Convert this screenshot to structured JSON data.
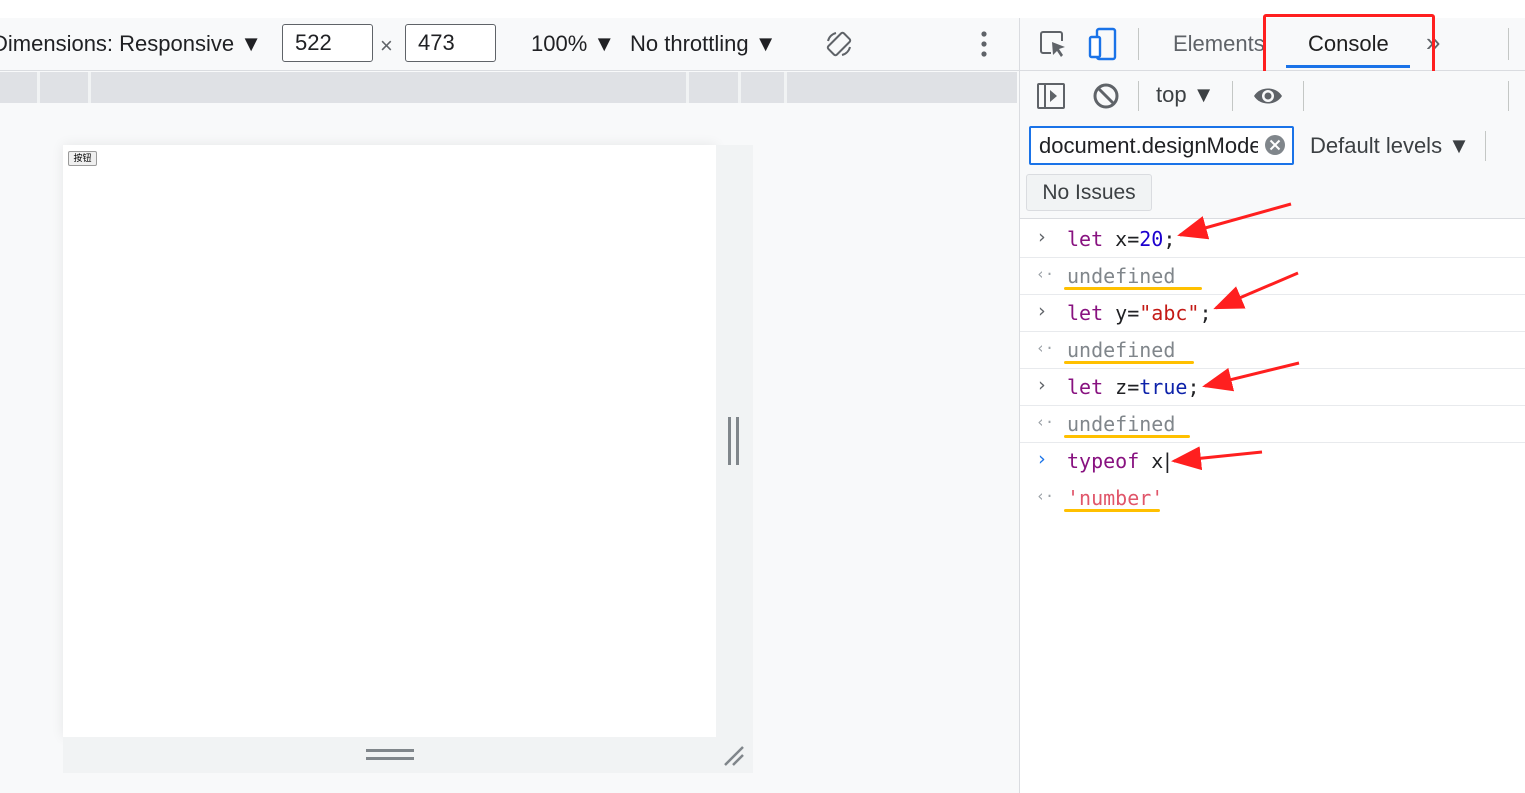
{
  "device_toolbar": {
    "dimensions_label": "Dimensions: Responsive ▼",
    "width_value": "522",
    "times_symbol": "×",
    "height_value": "473",
    "zoom": "100% ▼",
    "throttling": "No throttling ▼",
    "rotate_icon": "rotate-icon",
    "more_icon": "more-vertical-icon"
  },
  "page": {
    "button_label": "按钮"
  },
  "devtools": {
    "tabs": [
      {
        "label": "Elements"
      },
      {
        "label": "Console",
        "active": true
      },
      {
        "label": "»"
      }
    ],
    "console_toolbar": {
      "context": "top ▼"
    },
    "filter": {
      "value": "document.designMode",
      "levels": "Default levels ▼"
    },
    "issues_label": "No Issues",
    "console": [
      {
        "type": "input",
        "parts": [
          {
            "t": "let ",
            "c": "kw"
          },
          {
            "t": "x=",
            "c": "plain"
          },
          {
            "t": "20",
            "c": "num"
          },
          {
            "t": ";",
            "c": "plain"
          }
        ]
      },
      {
        "type": "output",
        "text": "undefined"
      },
      {
        "type": "input",
        "parts": [
          {
            "t": "let ",
            "c": "kw"
          },
          {
            "t": "y=",
            "c": "plain"
          },
          {
            "t": "\"abc\"",
            "c": "str"
          },
          {
            "t": ";",
            "c": "plain"
          }
        ]
      },
      {
        "type": "output",
        "text": "undefined"
      },
      {
        "type": "input",
        "parts": [
          {
            "t": "let ",
            "c": "kw"
          },
          {
            "t": "z=",
            "c": "plain"
          },
          {
            "t": "true",
            "c": "bool"
          },
          {
            "t": ";",
            "c": "plain"
          }
        ]
      },
      {
        "type": "output",
        "text": "undefined"
      },
      {
        "type": "input",
        "parts": [
          {
            "t": "typeof ",
            "c": "kw"
          },
          {
            "t": "x",
            "c": "plain"
          }
        ]
      },
      {
        "type": "output",
        "text": "'number'"
      }
    ]
  },
  "colors": {
    "accent": "#1a73e8",
    "annotation_red": "#ff1f1f",
    "annotation_yellow": "#ffc000"
  }
}
